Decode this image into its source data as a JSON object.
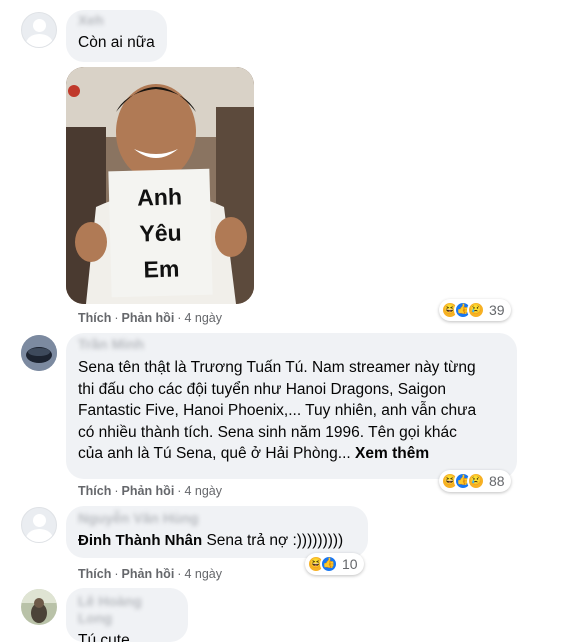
{
  "comments": [
    {
      "author": "Xeh",
      "text": "Còn ai nữa",
      "photo_sign": [
        "Anh",
        "Yêu",
        "Em"
      ],
      "actions": {
        "like": "Thích",
        "reply": "Phản hồi",
        "time": "4 ngày"
      },
      "reactions": {
        "icons": [
          "haha-icon",
          "like-icon",
          "sad-icon"
        ],
        "count": "39"
      }
    },
    {
      "author": "Trần Minh",
      "lines": [
        "Sena tên thật là Trương Tuấn Tú. Nam streamer này từng",
        "thi đấu cho các đội tuyển như Hanoi Dragons, Saigon",
        "Fantastic Five, Hanoi Phoenix,... Tuy nhiên, anh vẫn chưa",
        "có nhiều thành tích. Sena sinh năm 1996. Tên gọi khác",
        "của anh là Tú Sena, quê ở Hải Phòng..."
      ],
      "see_more": "Xem thêm",
      "actions": {
        "like": "Thích",
        "reply": "Phản hồi",
        "time": "4 ngày"
      },
      "reactions": {
        "icons": [
          "haha-icon",
          "like-icon",
          "sad-icon"
        ],
        "count": "88"
      }
    },
    {
      "author": "Nguyễn Văn Hùng",
      "tag": "Đinh Thành Nhân",
      "text": "Sena trả nợ :)))))))))",
      "actions": {
        "like": "Thích",
        "reply": "Phản hồi",
        "time": "4 ngày"
      },
      "reactions": {
        "icons": [
          "haha-icon",
          "like-icon"
        ],
        "count": "10"
      }
    },
    {
      "author": "Lê Hoàng Long",
      "text": "Tú cute"
    }
  ],
  "colors": {
    "bubble": "#f0f2f5",
    "meta": "#65676b",
    "like_blue": "#1877f2",
    "haha_yellow": "#f7b125"
  }
}
